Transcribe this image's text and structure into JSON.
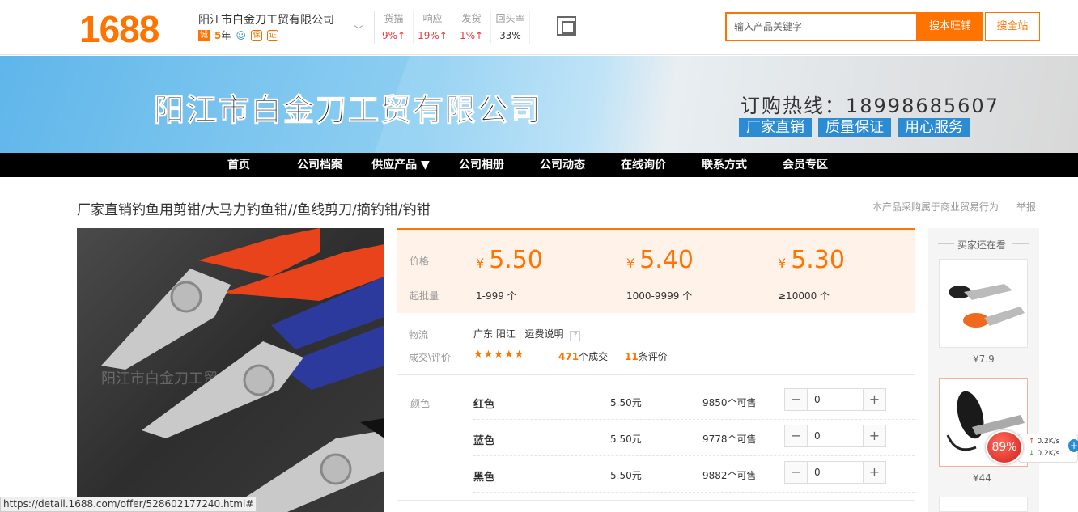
{
  "header": {
    "logo": "1688",
    "company_name": "阳江市白金刀工贸有限公司",
    "cheng_badge": "诚",
    "years": "5",
    "years_unit": "年",
    "stats": [
      {
        "label": "货描",
        "value": "9%↑",
        "color": "#e4393c"
      },
      {
        "label": "响应",
        "value": "19%↑",
        "color": "#e4393c"
      },
      {
        "label": "发货",
        "value": "1%↑",
        "color": "#e4393c"
      },
      {
        "label": "回头率",
        "value": "33%",
        "color": "#333333"
      }
    ],
    "search_placeholder": "输入产品关键字",
    "search_shop_button": "搜本旺铺",
    "search_all_button": "搜全站"
  },
  "banner": {
    "title": "阳江市白金刀工贸有限公司",
    "hotline": "订购热线：18998685607",
    "tags": [
      "厂家直销",
      "质量保证",
      "用心服务"
    ]
  },
  "nav": [
    "首页",
    "公司档案",
    "供应产品 ▼",
    "公司相册",
    "公司动态",
    "在线询价",
    "联系方式",
    "会员专区"
  ],
  "product": {
    "title": "厂家直销钓鱼用剪钳/大马力钓鱼钳//鱼线剪刀/摘钓钳/钓钳",
    "trade_note": "本产品采购属于商业贸易行为",
    "report": "举报",
    "watermark": "阳江市白金刀工贸",
    "price_label": "价格",
    "moq_label": "起批量",
    "currency": "¥",
    "tiers": [
      {
        "price": "5.50",
        "range": "1-999 个"
      },
      {
        "price": "5.40",
        "range": "1000-9999 个"
      },
      {
        "price": "5.30",
        "range": "≥10000 个"
      }
    ],
    "logistics_label": "物流",
    "logistics_value": "广东 阳江",
    "shipping_link": "运费说明",
    "deals_label": "成交\\评价",
    "stars": "★★★★★",
    "deals_count": "471",
    "deals_text": "个成交",
    "reviews_count": "11",
    "reviews_text": "条评价",
    "color_label": "颜色",
    "skus": [
      {
        "name": "红色",
        "price": "5.50元",
        "stock": "9850个可售",
        "qty": "0"
      },
      {
        "name": "蓝色",
        "price": "5.50元",
        "stock": "9778个可售",
        "qty": "0"
      },
      {
        "name": "黑色",
        "price": "5.50元",
        "stock": "9882个可售",
        "qty": "0"
      }
    ]
  },
  "sidebar": {
    "title": "买家还在看",
    "items": [
      {
        "price": "¥7.9"
      },
      {
        "price": "¥44"
      }
    ]
  },
  "status_bar": "https://detail.1688.com/offer/528602177240.html#",
  "speed_widget": {
    "percent": "89%",
    "up": "0.2K/s",
    "down": "0.2K/s"
  }
}
